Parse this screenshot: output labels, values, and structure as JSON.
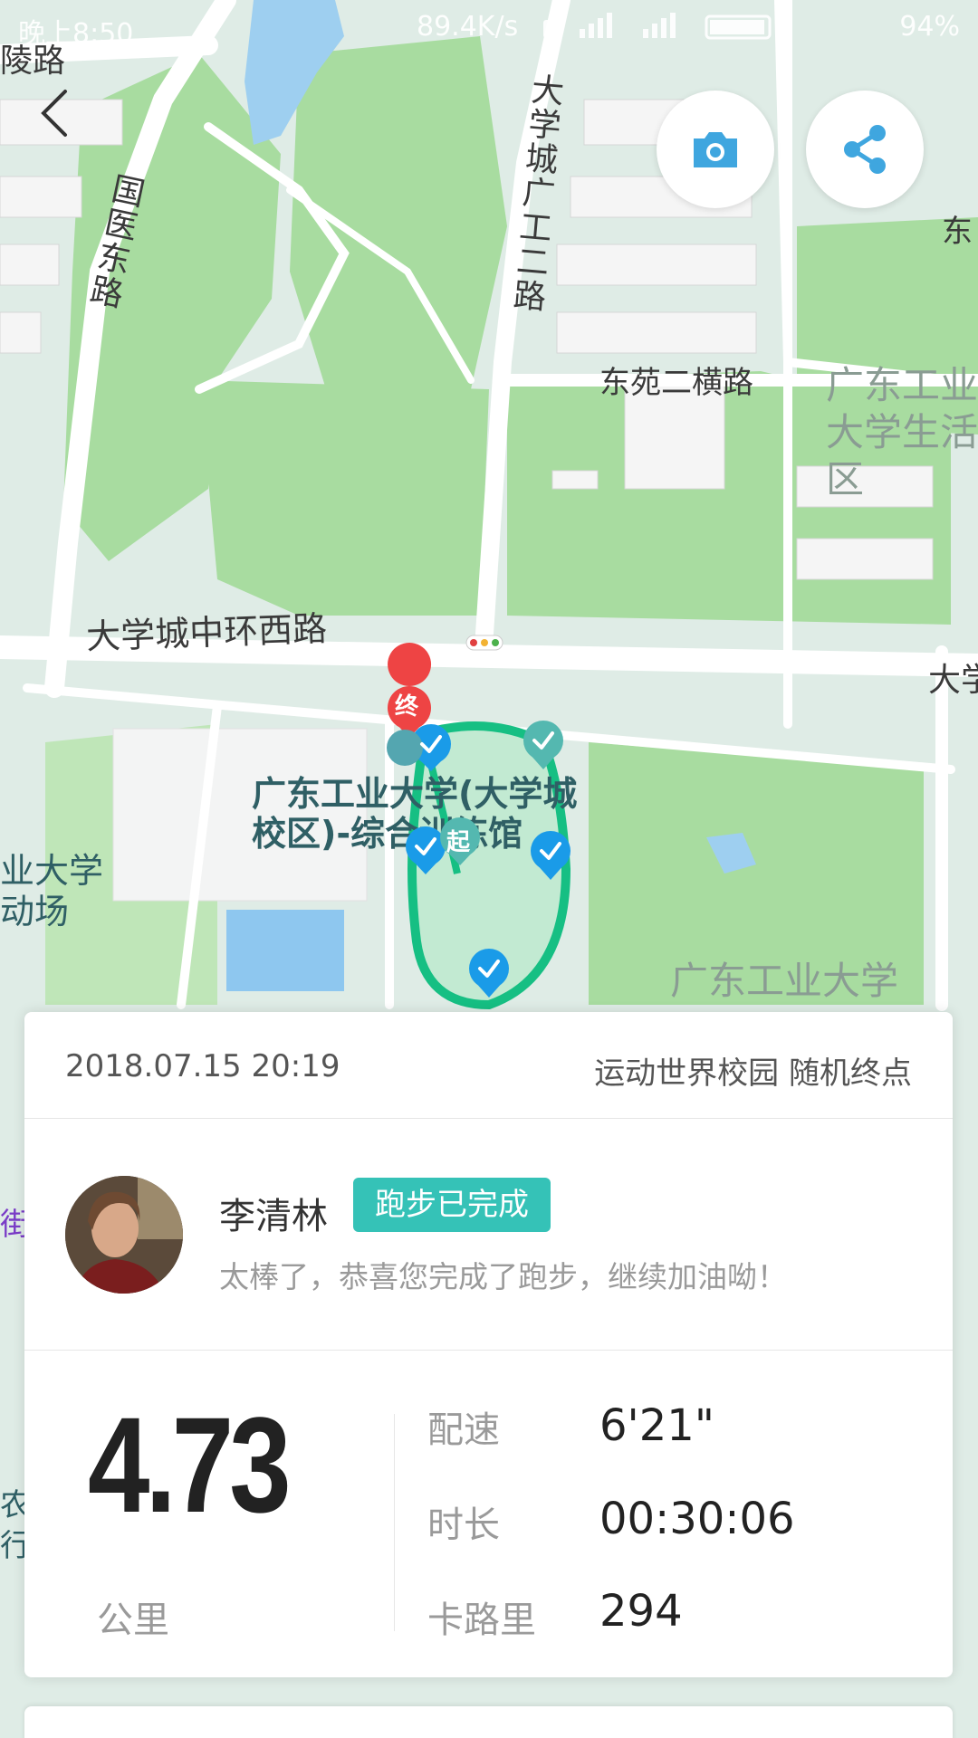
{
  "status_bar": {
    "time": "晚上8:50",
    "network_speed": "89.4K/s",
    "battery": "94%"
  },
  "map": {
    "roads": {
      "road_top_left": "陵路",
      "guoyi_east": "国医东路",
      "daxuecheng_guanggong": "大学城广工二路",
      "dongyuan": "东苑二横路",
      "zhonghuan_west": "大学城中环西路",
      "right_edge": "大学",
      "far_right_top": "东",
      "left_edge_purple": "街"
    },
    "areas": {
      "living_area": "广东工业大学生活区",
      "campus_right": "广东工业大学",
      "venue": "广东工业大学(大学城校区)-综合训练馆",
      "left_campus": "业大学",
      "left_campus_2": "动场",
      "left_bottom_1": "农",
      "left_bottom_2": "行"
    },
    "markers": {
      "end_label": "终",
      "start_label": "起"
    },
    "colors": {
      "route": "#16bf83",
      "checkpoint": "#1a9be8",
      "end_marker": "#ee4444"
    }
  },
  "card": {
    "date": "2018.07.15 20:19",
    "mode": "运动世界校园 随机终点",
    "user_name": "李清林",
    "badge": "跑步已完成",
    "congrats": "太棒了，恭喜您完成了跑步，继续加油呦！",
    "distance": "4.73",
    "distance_unit": "公里",
    "stats": [
      {
        "label": "配速",
        "value": "6'21\""
      },
      {
        "label": "时长",
        "value": "00:30:06"
      },
      {
        "label": "卡路里",
        "value": "294"
      }
    ],
    "badge_color": "#35c2b7"
  }
}
